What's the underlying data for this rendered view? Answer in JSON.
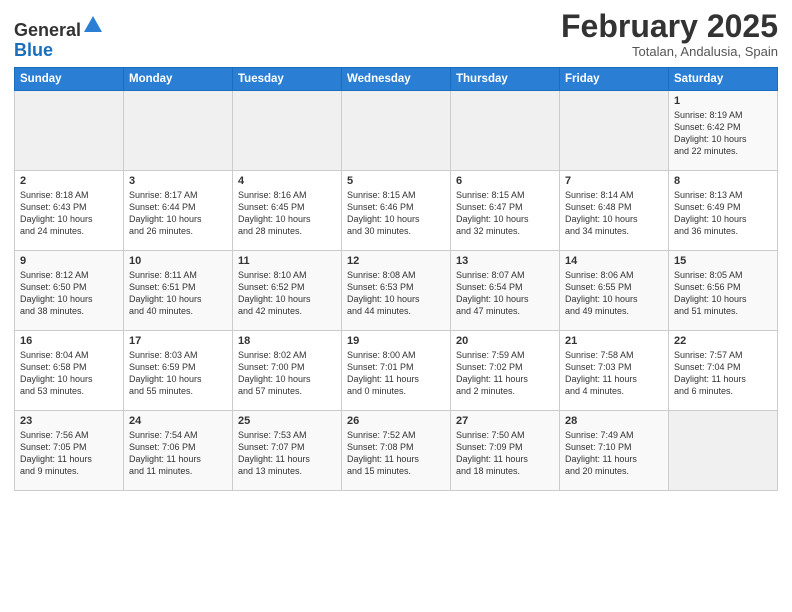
{
  "logo": {
    "general": "General",
    "blue": "Blue"
  },
  "header": {
    "month": "February 2025",
    "location": "Totalan, Andalusia, Spain"
  },
  "days_of_week": [
    "Sunday",
    "Monday",
    "Tuesday",
    "Wednesday",
    "Thursday",
    "Friday",
    "Saturday"
  ],
  "weeks": [
    [
      {
        "day": "",
        "info": ""
      },
      {
        "day": "",
        "info": ""
      },
      {
        "day": "",
        "info": ""
      },
      {
        "day": "",
        "info": ""
      },
      {
        "day": "",
        "info": ""
      },
      {
        "day": "",
        "info": ""
      },
      {
        "day": "1",
        "info": "Sunrise: 8:19 AM\nSunset: 6:42 PM\nDaylight: 10 hours\nand 22 minutes."
      }
    ],
    [
      {
        "day": "2",
        "info": "Sunrise: 8:18 AM\nSunset: 6:43 PM\nDaylight: 10 hours\nand 24 minutes."
      },
      {
        "day": "3",
        "info": "Sunrise: 8:17 AM\nSunset: 6:44 PM\nDaylight: 10 hours\nand 26 minutes."
      },
      {
        "day": "4",
        "info": "Sunrise: 8:16 AM\nSunset: 6:45 PM\nDaylight: 10 hours\nand 28 minutes."
      },
      {
        "day": "5",
        "info": "Sunrise: 8:15 AM\nSunset: 6:46 PM\nDaylight: 10 hours\nand 30 minutes."
      },
      {
        "day": "6",
        "info": "Sunrise: 8:15 AM\nSunset: 6:47 PM\nDaylight: 10 hours\nand 32 minutes."
      },
      {
        "day": "7",
        "info": "Sunrise: 8:14 AM\nSunset: 6:48 PM\nDaylight: 10 hours\nand 34 minutes."
      },
      {
        "day": "8",
        "info": "Sunrise: 8:13 AM\nSunset: 6:49 PM\nDaylight: 10 hours\nand 36 minutes."
      }
    ],
    [
      {
        "day": "9",
        "info": "Sunrise: 8:12 AM\nSunset: 6:50 PM\nDaylight: 10 hours\nand 38 minutes."
      },
      {
        "day": "10",
        "info": "Sunrise: 8:11 AM\nSunset: 6:51 PM\nDaylight: 10 hours\nand 40 minutes."
      },
      {
        "day": "11",
        "info": "Sunrise: 8:10 AM\nSunset: 6:52 PM\nDaylight: 10 hours\nand 42 minutes."
      },
      {
        "day": "12",
        "info": "Sunrise: 8:08 AM\nSunset: 6:53 PM\nDaylight: 10 hours\nand 44 minutes."
      },
      {
        "day": "13",
        "info": "Sunrise: 8:07 AM\nSunset: 6:54 PM\nDaylight: 10 hours\nand 47 minutes."
      },
      {
        "day": "14",
        "info": "Sunrise: 8:06 AM\nSunset: 6:55 PM\nDaylight: 10 hours\nand 49 minutes."
      },
      {
        "day": "15",
        "info": "Sunrise: 8:05 AM\nSunset: 6:56 PM\nDaylight: 10 hours\nand 51 minutes."
      }
    ],
    [
      {
        "day": "16",
        "info": "Sunrise: 8:04 AM\nSunset: 6:58 PM\nDaylight: 10 hours\nand 53 minutes."
      },
      {
        "day": "17",
        "info": "Sunrise: 8:03 AM\nSunset: 6:59 PM\nDaylight: 10 hours\nand 55 minutes."
      },
      {
        "day": "18",
        "info": "Sunrise: 8:02 AM\nSunset: 7:00 PM\nDaylight: 10 hours\nand 57 minutes."
      },
      {
        "day": "19",
        "info": "Sunrise: 8:00 AM\nSunset: 7:01 PM\nDaylight: 11 hours\nand 0 minutes."
      },
      {
        "day": "20",
        "info": "Sunrise: 7:59 AM\nSunset: 7:02 PM\nDaylight: 11 hours\nand 2 minutes."
      },
      {
        "day": "21",
        "info": "Sunrise: 7:58 AM\nSunset: 7:03 PM\nDaylight: 11 hours\nand 4 minutes."
      },
      {
        "day": "22",
        "info": "Sunrise: 7:57 AM\nSunset: 7:04 PM\nDaylight: 11 hours\nand 6 minutes."
      }
    ],
    [
      {
        "day": "23",
        "info": "Sunrise: 7:56 AM\nSunset: 7:05 PM\nDaylight: 11 hours\nand 9 minutes."
      },
      {
        "day": "24",
        "info": "Sunrise: 7:54 AM\nSunset: 7:06 PM\nDaylight: 11 hours\nand 11 minutes."
      },
      {
        "day": "25",
        "info": "Sunrise: 7:53 AM\nSunset: 7:07 PM\nDaylight: 11 hours\nand 13 minutes."
      },
      {
        "day": "26",
        "info": "Sunrise: 7:52 AM\nSunset: 7:08 PM\nDaylight: 11 hours\nand 15 minutes."
      },
      {
        "day": "27",
        "info": "Sunrise: 7:50 AM\nSunset: 7:09 PM\nDaylight: 11 hours\nand 18 minutes."
      },
      {
        "day": "28",
        "info": "Sunrise: 7:49 AM\nSunset: 7:10 PM\nDaylight: 11 hours\nand 20 minutes."
      },
      {
        "day": "",
        "info": ""
      }
    ]
  ]
}
